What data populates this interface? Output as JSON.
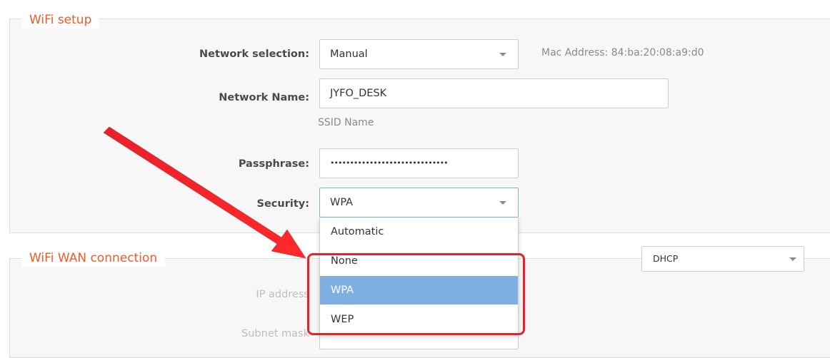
{
  "wifi_setup": {
    "legend": "WiFi setup",
    "network_selection": {
      "label": "Network selection:",
      "value": "Manual"
    },
    "mac_address": "Mac Address: 84:ba:20:08:a9:d0",
    "network_name": {
      "label": "Network Name:",
      "value": "JYFO_DESK",
      "hint": "SSID Name"
    },
    "passphrase": {
      "label": "Passphrase:",
      "masked_value": "••••••••••••••••••••••••••••••"
    },
    "security": {
      "label": "Security:",
      "value": "WPA",
      "options": [
        "Automatic",
        "None",
        "WPA",
        "WEP"
      ],
      "selected_index": 2
    }
  },
  "wifi_wan": {
    "legend": "WiFi WAN connection",
    "mode": {
      "value": "DHCP"
    },
    "ip_address": {
      "label": "IP address"
    },
    "subnet_mask": {
      "label": "Subnet mask"
    }
  },
  "colors": {
    "legend": "#f05a28",
    "selected_option": "#7eafe0",
    "annotation": "#e8212b"
  },
  "icons": [
    "dropdown-caret-icon",
    "annotation-arrow"
  ]
}
